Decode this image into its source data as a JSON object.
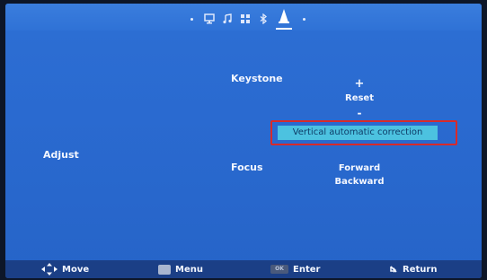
{
  "menu": {
    "categories": [
      "monitor-icon",
      "music-icon",
      "grid-icon",
      "bluetooth-icon",
      "projector-icon"
    ],
    "active_category": "projector-icon"
  },
  "settings": {
    "keystone_label": "Keystone",
    "keystone_plus": "+",
    "keystone_reset": "Reset",
    "keystone_minus": "-",
    "vertical_auto_correction": "Vertical automatic correction",
    "adjust_label": "Adjust",
    "focus_label": "Focus",
    "focus_forward": "Forward",
    "focus_backward": "Backward"
  },
  "footer": {
    "move": "Move",
    "menu": "Menu",
    "enter": "Enter",
    "return": "Return",
    "enter_key": "OK"
  },
  "colors": {
    "background": "#2a6ad0",
    "highlight": "#4cc2e0",
    "selection_border": "#d82a2a",
    "footer": "#1b3f86"
  }
}
